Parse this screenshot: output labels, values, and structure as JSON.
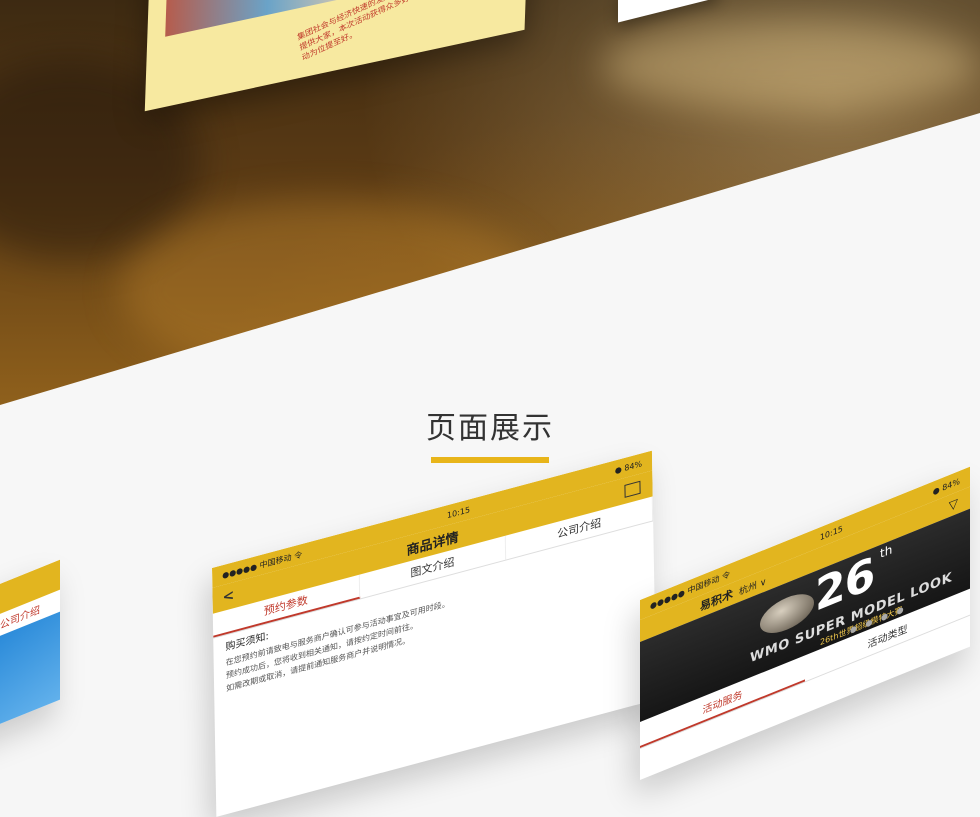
{
  "top_card": {
    "text": "集团社会与经济快速的发展，生活与工作压力也越来越大。所以为了提供大家，本次活动获得众多好员交流，运动，为、休、娱交友，运动为位提至好。"
  },
  "section": {
    "title": "页面展示"
  },
  "phone_left": {
    "tab": "公司介绍"
  },
  "phone_middle": {
    "carrier": "●●●●● 中国移动 令",
    "time": "10:15",
    "battery": "● 84%",
    "title": "商品详情",
    "back": "<",
    "tabs": [
      "预约参数",
      "图文介绍",
      "公司介绍"
    ],
    "purchase_heading": "购买须知:",
    "lines": [
      "在您预约前请致电与服务商户确认可参与活动事宜及可用时段。",
      "预约成功后，您将收到相关通知，请按约定时间前往。",
      "如需改期或取消，请提前通知服务商户并说明情况。"
    ]
  },
  "phone_right": {
    "carrier": "●●●●● 中国移动 令",
    "time": "10:15",
    "battery": "● 84%",
    "title": "易积术",
    "city": "杭州 ∨",
    "filter": "▽",
    "user_icon": "ⓧ",
    "banner_number": "26",
    "banner_sup": "th",
    "banner_en": "WMO SUPER MODEL LOOK",
    "banner_cn": "26th世界超级模特大赛",
    "banner_dots": "● ● ● ●",
    "tabs": [
      "活动服务",
      "活动类型"
    ],
    "row_text": "活动类型"
  },
  "colors": {
    "accent": "#e2b51f",
    "highlight": "#c0392b",
    "title_bar": "#e8b51a"
  }
}
